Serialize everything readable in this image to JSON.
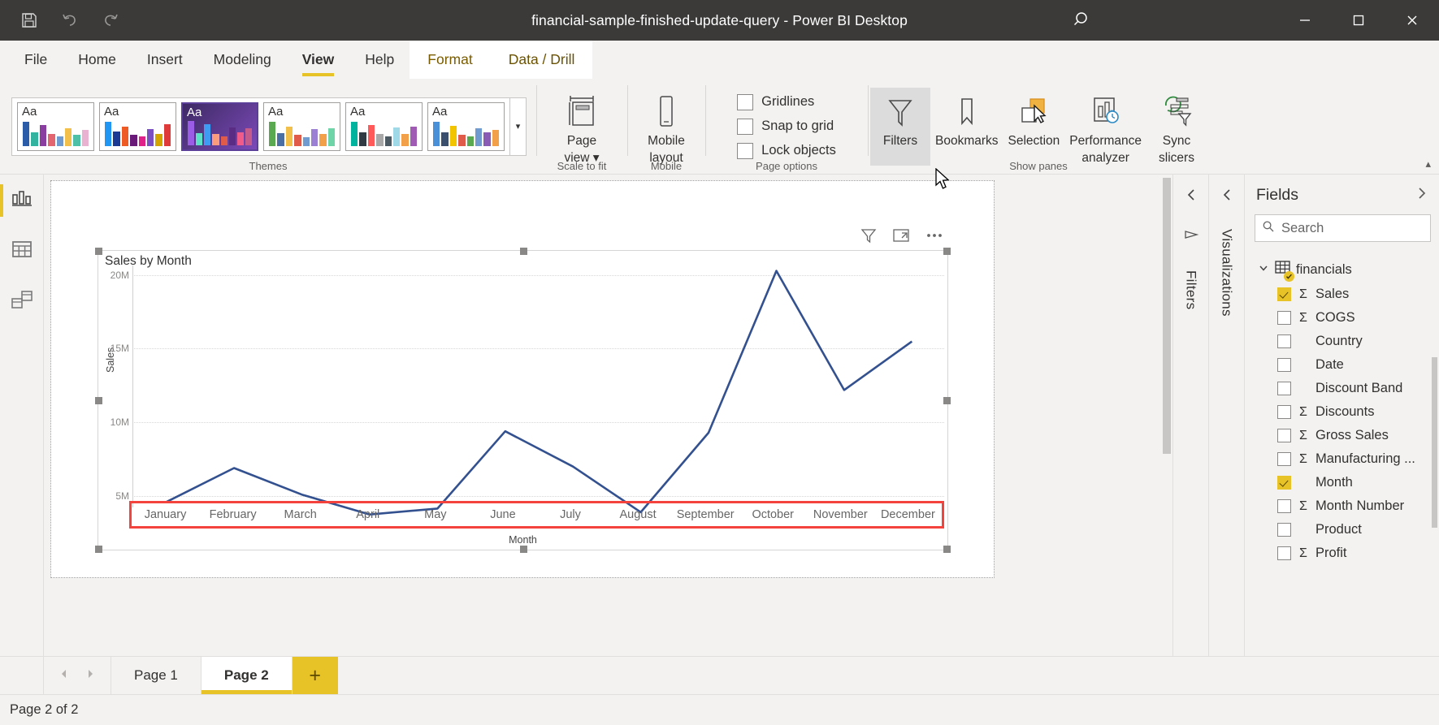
{
  "titlebar": {
    "document_title": "financial-sample-finished-update-query - Power BI Desktop",
    "save_icon": "save-icon",
    "undo_icon": "undo-icon",
    "redo_icon": "redo-icon",
    "search_icon": "search-icon",
    "minimize_label": "minimize-icon",
    "maximize_label": "maximize-icon",
    "close_label": "close-icon"
  },
  "menu": {
    "tabs": [
      {
        "label": "File",
        "active": false,
        "contextual": false
      },
      {
        "label": "Home",
        "active": false,
        "contextual": false
      },
      {
        "label": "Insert",
        "active": false,
        "contextual": false
      },
      {
        "label": "Modeling",
        "active": false,
        "contextual": false
      },
      {
        "label": "View",
        "active": true,
        "contextual": false
      },
      {
        "label": "Help",
        "active": false,
        "contextual": false
      },
      {
        "label": "Format",
        "active": false,
        "contextual": true
      },
      {
        "label": "Data / Drill",
        "active": false,
        "contextual": true
      }
    ]
  },
  "ribbon": {
    "groups": {
      "themes": {
        "label": "Themes",
        "more_icon": "chevron-down-icon"
      },
      "scale_to_fit": {
        "label": "Scale to fit"
      },
      "mobile": {
        "label": "Mobile"
      },
      "page_options": {
        "label": "Page options"
      },
      "show_panes": {
        "label": "Show panes"
      }
    },
    "page_view": {
      "label_line1": "Page",
      "label_line2": "view",
      "icon": "page-view-icon",
      "dropdown_icon": "chevron-down-icon"
    },
    "mobile_layout": {
      "label_line1": "Mobile",
      "label_line2": "layout",
      "icon": "mobile-layout-icon"
    },
    "checkboxes": [
      {
        "label": "Gridlines",
        "checked": false
      },
      {
        "label": "Snap to grid",
        "checked": false
      },
      {
        "label": "Lock objects",
        "checked": false
      }
    ],
    "panes": [
      {
        "label": "Filters",
        "icon": "filter-funnel-icon",
        "active": true
      },
      {
        "label": "Bookmarks",
        "icon": "bookmark-icon",
        "active": false
      },
      {
        "label": "Selection",
        "icon": "selection-icon",
        "active": false
      },
      {
        "label_line1": "Performance",
        "label_line2": "analyzer",
        "icon": "performance-analyzer-icon",
        "active": false
      },
      {
        "label_line1": "Sync",
        "label_line2": "slicers",
        "icon": "sync-slicers-icon",
        "active": false
      }
    ],
    "collapse_icon": "chevron-up-icon",
    "theme_cards": [
      {
        "aa": "Aa",
        "selected": false,
        "bars": [
          "#2b5ca8",
          "#31b3a0",
          "#8a3fa0",
          "#e2656f",
          "#6f9bd1",
          "#f2c04a",
          "#4fc0a8",
          "#e8b2d0"
        ]
      },
      {
        "aa": "Aa",
        "selected": false,
        "bars": [
          "#2196f3",
          "#1b3a93",
          "#ef5b25",
          "#6a1b7a",
          "#e0218a",
          "#7b4fc4",
          "#d4a500",
          "#e03b3b"
        ]
      },
      {
        "aa": "Aa",
        "selected": true,
        "bars": [
          "#9b5de5",
          "#5ee0c8",
          "#3f9bf2",
          "#f99b7d",
          "#e05b4a",
          "#5b2c83",
          "#f05b8a",
          "#c45b8a"
        ]
      },
      {
        "aa": "Aa",
        "selected": false,
        "bars": [
          "#5aa84f",
          "#4a6fa5",
          "#f2c04a",
          "#e05b4a",
          "#6f9bd1",
          "#9b7fd4",
          "#f2a14a",
          "#6fd4a8"
        ]
      },
      {
        "aa": "Aa",
        "selected": false,
        "bars": [
          "#00b39f",
          "#2f3a42",
          "#ff5a5a",
          "#a8a8a8",
          "#4c5a63",
          "#9fd9e8",
          "#f2a14a",
          "#a05bb5"
        ]
      },
      {
        "aa": "Aa",
        "selected": false,
        "bars": [
          "#4a90d9",
          "#3a4f6e",
          "#f2c400",
          "#e05b4a",
          "#5aa84f",
          "#6f9bd1",
          "#8a5bb5",
          "#f2a14a"
        ]
      }
    ]
  },
  "leftrail": {
    "items": [
      {
        "name": "report-view",
        "icon": "report-chart-icon",
        "active": true
      },
      {
        "name": "data-view",
        "icon": "data-table-icon",
        "active": false
      },
      {
        "name": "model-view",
        "icon": "model-relationship-icon",
        "active": false
      }
    ]
  },
  "panes": {
    "filters_strip": {
      "label": "Filters",
      "collapse_icon": "chevron-left-icon",
      "pane_icon": "filter-icon"
    },
    "visualizations_strip": {
      "label": "Visualizations",
      "collapse_icon": "chevron-left-icon"
    }
  },
  "fields": {
    "title": "Fields",
    "expand_icon": "chevron-right-icon",
    "search": {
      "placeholder": "Search",
      "value": "",
      "icon": "search-icon"
    },
    "table": {
      "name": "financials",
      "expanded": true,
      "expand_icon": "chevron-down-icon",
      "table_icon": "table-icon",
      "checked": true
    },
    "items": [
      {
        "label": "Sales",
        "checked": true,
        "measure": true
      },
      {
        "label": "COGS",
        "checked": false,
        "measure": true
      },
      {
        "label": "Country",
        "checked": false,
        "measure": false
      },
      {
        "label": "Date",
        "checked": false,
        "measure": false
      },
      {
        "label": "Discount Band",
        "checked": false,
        "measure": false
      },
      {
        "label": "Discounts",
        "checked": false,
        "measure": true
      },
      {
        "label": "Gross Sales",
        "checked": false,
        "measure": true
      },
      {
        "label": "Manufacturing ...",
        "checked": false,
        "measure": true
      },
      {
        "label": "Month",
        "checked": true,
        "measure": false
      },
      {
        "label": "Month Number",
        "checked": false,
        "measure": true
      },
      {
        "label": "Product",
        "checked": false,
        "measure": false
      },
      {
        "label": "Profit",
        "checked": false,
        "measure": true
      }
    ]
  },
  "visual": {
    "title": "Sales by Month",
    "header_icons": [
      {
        "name": "filter-icon"
      },
      {
        "name": "focus-mode-icon"
      },
      {
        "name": "more-options-icon"
      }
    ]
  },
  "chart_data": {
    "type": "line",
    "title": "Sales by Month",
    "xlabel": "Month",
    "ylabel": "Sales",
    "categories": [
      "January",
      "February",
      "March",
      "April",
      "May",
      "June",
      "July",
      "August",
      "September",
      "October",
      "November",
      "December"
    ],
    "values": [
      4600000,
      6900000,
      5100000,
      3750000,
      4150000,
      9400000,
      7000000,
      3900000,
      9300000,
      20300000,
      12200000,
      15500000
    ],
    "ylim": [
      3300000,
      21500000
    ],
    "yticks": [
      5000000,
      10000000,
      15000000,
      20000000
    ],
    "ytick_labels": [
      "5M",
      "10M",
      "15M",
      "20M"
    ],
    "series": [
      {
        "name": "Sales",
        "color": "#33508f",
        "values": [
          4600000,
          6900000,
          5100000,
          3750000,
          4150000,
          9400000,
          7000000,
          3900000,
          9300000,
          20300000,
          12200000,
          15500000
        ]
      }
    ],
    "grid": true,
    "legend": "none",
    "annotations": [
      {
        "type": "highlight-box",
        "target": "x-axis-labels",
        "color": "#f4433c"
      }
    ]
  },
  "pagebar": {
    "prev_icon": "chevron-left-icon",
    "next_icon": "chevron-right-icon",
    "tabs": [
      {
        "label": "Page 1",
        "active": false
      },
      {
        "label": "Page 2",
        "active": true
      }
    ],
    "add_label": "+"
  },
  "status": {
    "text": "Page 2 of 2"
  },
  "colors": {
    "accent_yellow": "#e8c328",
    "line_blue": "#33508f",
    "highlight_red": "#f4433c",
    "titlebar_bg": "#3b3a39",
    "chrome_bg": "#f3f2f1"
  }
}
